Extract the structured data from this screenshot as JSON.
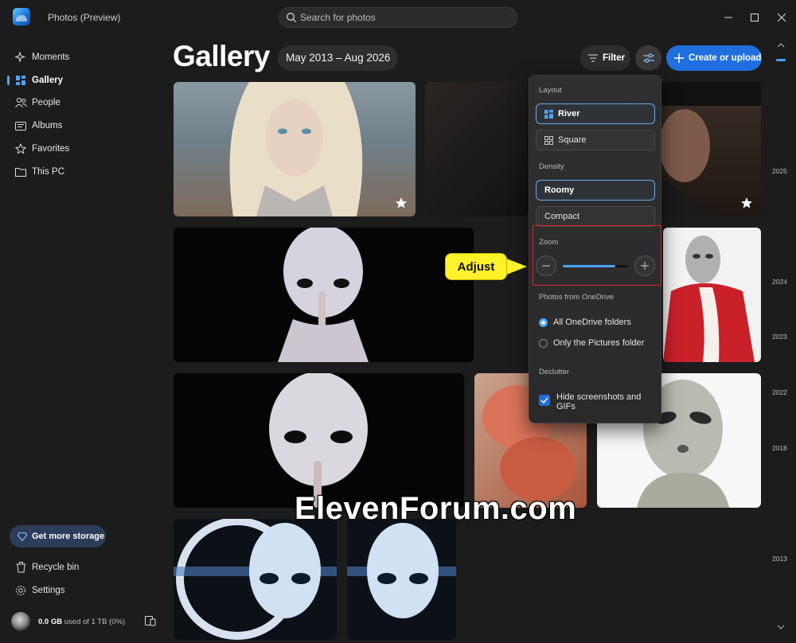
{
  "window": {
    "title": "Photos (Preview)"
  },
  "search": {
    "placeholder": "Search for photos"
  },
  "sidebar": {
    "items": [
      {
        "label": "Moments",
        "icon": "sparkle-icon"
      },
      {
        "label": "Gallery",
        "icon": "gallery-grid-icon",
        "active": true
      },
      {
        "label": "People",
        "icon": "people-icon"
      },
      {
        "label": "Albums",
        "icon": "album-icon"
      },
      {
        "label": "Favorites",
        "icon": "star-icon"
      },
      {
        "label": "This PC",
        "icon": "folder-icon"
      }
    ],
    "storage_button": "Get more storage",
    "recycle_bin": "Recycle bin",
    "settings": "Settings",
    "usage": {
      "amount": "0.0 GB",
      "detail": "used of 1 TB (0%)"
    }
  },
  "header": {
    "title": "Gallery",
    "date_range": "May 2013 – Aug 2026",
    "filter_label": "Filter",
    "create_label": "Create or upload"
  },
  "timeline": {
    "years": [
      "2025",
      "2024",
      "2023",
      "2022",
      "2018",
      "2013"
    ]
  },
  "layout_popup": {
    "layout_heading": "Layout",
    "layout_options": [
      "River",
      "Square"
    ],
    "layout_selected": "River",
    "density_heading": "Density",
    "density_options": [
      "Roomy",
      "Compact"
    ],
    "density_selected": "Roomy",
    "zoom_heading": "Zoom",
    "zoom_level": 0.8,
    "onedrive_heading": "Photos from OneDrive",
    "onedrive_options": [
      "All OneDrive folders",
      "Only the Pictures folder"
    ],
    "onedrive_selected": "All OneDrive folders",
    "declutter_heading": "Declutter",
    "declutter_option": "Hide screenshots and GIFs",
    "declutter_checked": true
  },
  "annotation": {
    "label": "Adjust"
  },
  "watermark": "ElevenForum.com",
  "colors": {
    "accent": "#1f6fde",
    "annotation_box": "#e0232a",
    "callout": "#fff22b"
  }
}
